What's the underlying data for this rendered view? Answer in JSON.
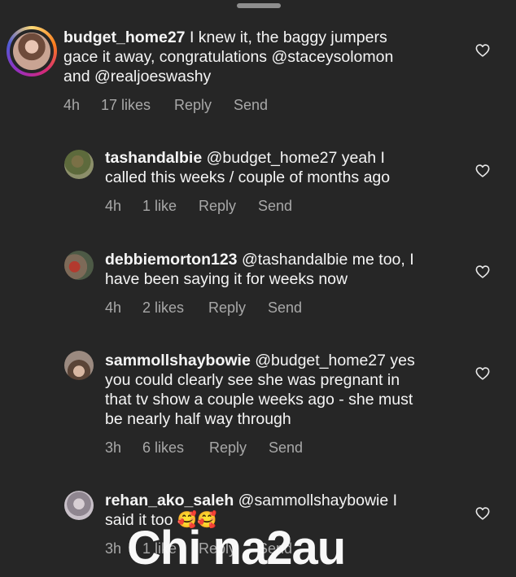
{
  "comments": [
    {
      "username": "budget_home27",
      "text": " I knew it, the baggy jumpers\ngace it away, congratulations @staceysolomon\nand @realjoeswashy",
      "time": "4h",
      "likes": "17 likes",
      "reply": "Reply",
      "send": "Send"
    },
    {
      "username": "tashandalbie",
      "text": " @budget_home27 yeah I\ncalled this weeks / couple of months ago",
      "time": "4h",
      "likes": "1 like",
      "reply": "Reply",
      "send": "Send"
    },
    {
      "username": "debbiemorton123",
      "text": " @tashandalbie me too, I\nhave been saying it for weeks now",
      "time": "4h",
      "likes": "2 likes",
      "reply": "Reply",
      "send": "Send"
    },
    {
      "username": "sammollshaybowie",
      "text": " @budget_home27 yes\nyou could clearly see she was pregnant in\nthat tv show a couple weeks ago - she must\nbe nearly half way through",
      "time": "3h",
      "likes": "6 likes",
      "reply": "Reply",
      "send": "Send"
    },
    {
      "username": "rehan_ako_saleh",
      "text": " @sammollshaybowie I\nsaid it too 🥰🥰",
      "time": "3h",
      "likes": "1 like",
      "reply": "Reply",
      "send": "Send"
    }
  ],
  "watermark": "Chi na2au",
  "colors": {
    "background": "#262626",
    "text": "#f5f5f5",
    "meta": "#a8a8a8"
  }
}
